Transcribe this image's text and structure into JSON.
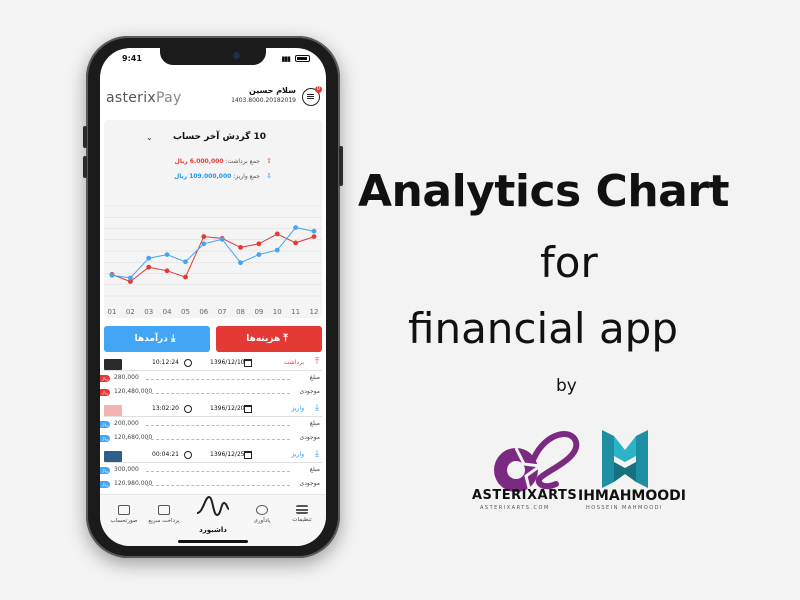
{
  "status_bar": {
    "time": "9:41"
  },
  "header": {
    "logo_main": "asterix",
    "logo_accent": "Pay",
    "greeting": "سلام حسین",
    "account_number": "1403.8000.20182019",
    "notification_count": "0"
  },
  "chart_card": {
    "title": "10 گردش آخر حساب",
    "withdraw_label": "جمع برداشت:",
    "withdraw_value": "6.000,000",
    "withdraw_unit": "ریال",
    "deposit_label": "جمع واریز:",
    "deposit_value": "109.000,000",
    "deposit_unit": "ریال"
  },
  "chart_data": {
    "type": "line",
    "categories": [
      "01",
      "02",
      "03",
      "04",
      "05",
      "06",
      "07",
      "08",
      "09",
      "10",
      "11",
      "12"
    ],
    "series": [
      {
        "color": "#e53935",
        "values": [
          2.4,
          1.6,
          3.2,
          2.8,
          2.1,
          6.6,
          6.4,
          5.4,
          5.8,
          6.9,
          5.9,
          6.6
        ]
      },
      {
        "color": "#42a5f5",
        "values": [
          2.3,
          2.0,
          4.2,
          4.6,
          3.8,
          5.8,
          6.3,
          3.7,
          4.6,
          5.1,
          7.6,
          7.2
        ]
      }
    ],
    "ylim": [
      0,
      10
    ],
    "grid": true
  },
  "actions": {
    "expense_label": "هزینه‌ها",
    "income_label": "درآمدها"
  },
  "transactions": [
    {
      "type_label": "برداشت",
      "kind": "w",
      "date": "1396/12/10",
      "time": "10:12:24",
      "amount": "280,000",
      "amount_label": "مبلغ",
      "balance": "120,480,000",
      "balance_label": "موجودی",
      "tag": "ریال",
      "card_color": "#2b2b2b"
    },
    {
      "type_label": "واریز",
      "kind": "d",
      "date": "1396/12/20",
      "time": "13:02:20",
      "amount": "200,000",
      "amount_label": "مبلغ",
      "balance": "120,680,000",
      "balance_label": "موجودی",
      "tag": "ریال",
      "card_color": "#f3b3b3"
    },
    {
      "type_label": "واریز",
      "kind": "d",
      "date": "1396/12/25",
      "time": "00:04:21",
      "amount": "300,000",
      "amount_label": "مبلغ",
      "balance": "120,980,000",
      "balance_label": "موجودی",
      "tag": "ریال",
      "card_color": "#2d5f8a"
    }
  ],
  "tabbar": {
    "settings": "تنظیمات",
    "reminder": "یادآوری",
    "dashboard": "داشبورد",
    "quick_pay": "پرداخت سریع",
    "statement": "صورتحساب"
  },
  "promo": {
    "headline": "Analytics Chart",
    "line2": "for",
    "line3": "financial app",
    "by": "by",
    "brand1_name": "ASTERIXARTS",
    "brand1_sub": "ASTERIXARTS.COM",
    "brand1_color": "#7b2a82",
    "brand2_name": "IHMAHMOODI",
    "brand2_sub": "HOSSEIN MAHMOODI",
    "brand2_color": "#2bb3c8"
  }
}
